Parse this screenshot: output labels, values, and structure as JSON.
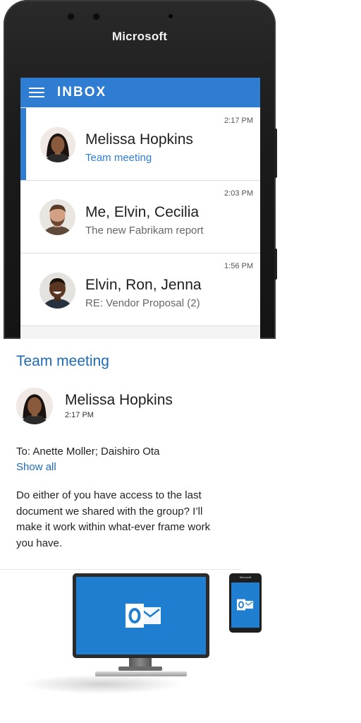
{
  "device": {
    "brand": "Microsoft"
  },
  "app": {
    "header_title": "INBOX",
    "accent_color": "#2f7dd3",
    "link_color": "#1e6ab5"
  },
  "inbox": {
    "messages": [
      {
        "time": "2:17 PM",
        "sender": "Melissa Hopkins",
        "subject": "Team meeting",
        "selected": true,
        "avatar": "woman-avatar"
      },
      {
        "time": "2:03 PM",
        "sender": "Me, Elvin, Cecilia",
        "subject": "The new Fabrikam report",
        "selected": false,
        "avatar": "bearded-man-avatar"
      },
      {
        "time": "1:56 PM",
        "sender": "Elvin, Ron, Jenna",
        "subject": "RE: Vendor Proposal (2)",
        "selected": false,
        "avatar": "smiling-man-avatar"
      }
    ]
  },
  "reading_pane": {
    "subject": "Team meeting",
    "sender": "Melissa Hopkins",
    "time": "2:17 PM",
    "to": "To: Anette Moller; Daishiro Ota",
    "show_all": "Show all",
    "body": "Do either of you have access to the last document we shared with the group? I’ll make it work within what-ever frame work you have."
  },
  "illustration": {
    "icon": "outlook-logo-icon"
  }
}
